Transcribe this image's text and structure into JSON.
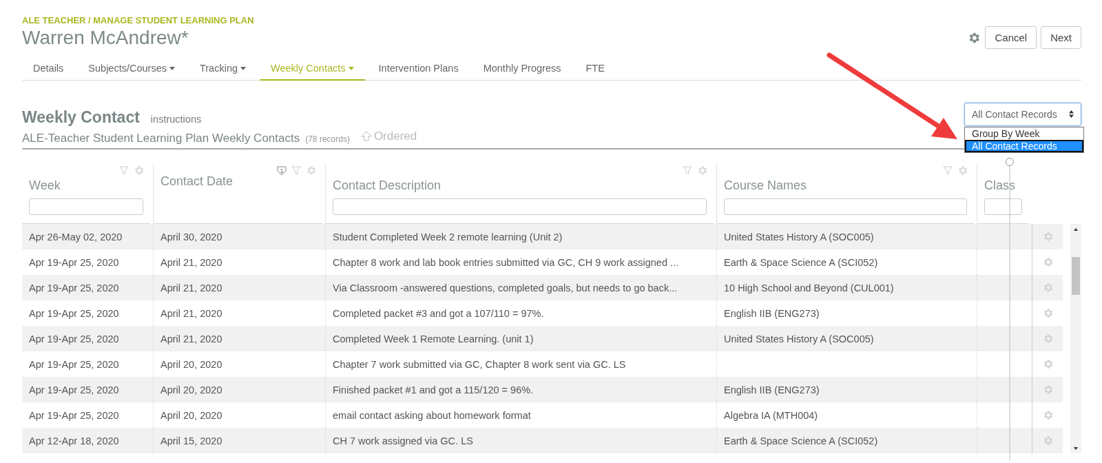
{
  "breadcrumb": "ALE TEACHER / MANAGE STUDENT LEARNING PLAN",
  "title": "Warren McAndrew*",
  "header_buttons": [
    "Cancel",
    "Next"
  ],
  "tabs": [
    {
      "label": "Details",
      "has_menu": false,
      "selected": false
    },
    {
      "label": "Subjects/Courses",
      "has_menu": true,
      "selected": false
    },
    {
      "label": "Tracking",
      "has_menu": true,
      "selected": false
    },
    {
      "label": "Weekly Contacts",
      "has_menu": true,
      "selected": true
    },
    {
      "label": "Intervention Plans",
      "has_menu": false,
      "selected": false
    },
    {
      "label": "Monthly Progress",
      "has_menu": false,
      "selected": false
    },
    {
      "label": "FTE",
      "has_menu": false,
      "selected": false
    }
  ],
  "section": {
    "title": "Weekly Contact",
    "link": "instructions"
  },
  "view_select": {
    "value": "All Contact Records",
    "options": [
      {
        "label": "Group By Week",
        "selected": false
      },
      {
        "label": "All Contact Records",
        "selected": true
      }
    ]
  },
  "list_title": {
    "title": "ALE-Teacher Student Learning Plan Weekly Contacts",
    "count": "(78 records)",
    "order": "Ordered"
  },
  "table": {
    "columns": [
      {
        "label": "Week",
        "tools": true,
        "filter_field": true
      },
      {
        "label": "Contact Date",
        "tools": true,
        "filter_field": false,
        "sort_badge": "1"
      },
      {
        "label": "Contact Description",
        "tools": true,
        "filter_field": true
      },
      {
        "label": "Course Names",
        "tools": true,
        "filter_field": true
      },
      {
        "label": "Class",
        "tools": false,
        "filter_field": true
      }
    ],
    "rows": [
      [
        "Apr 26-May 02, 2020",
        "April 30, 2020",
        "Student Completed Week 2 remote learning (Unit 2)",
        "United States History A (SOC005)"
      ],
      [
        "Apr 19-Apr 25, 2020",
        "April 21, 2020",
        "Chapter 8 work and lab book entries submitted via GC, CH 9 work assigned ...",
        "Earth & Space Science A (SCI052)"
      ],
      [
        "Apr 19-Apr 25, 2020",
        "April 21, 2020",
        "Via Classroom -answered questions, completed goals, but needs to go back...",
        "10 High School and Beyond (CUL001)"
      ],
      [
        "Apr 19-Apr 25, 2020",
        "April 21, 2020",
        "Completed packet #3 and got a 107/110 = 97%.",
        "English IIB (ENG273)"
      ],
      [
        "Apr 19-Apr 25, 2020",
        "April 21, 2020",
        "Completed Week 1 Remote Learning. (unit 1)",
        "United States History A (SOC005)"
      ],
      [
        "Apr 19-Apr 25, 2020",
        "April 20, 2020",
        "Chapter 7 work submitted via GC, Chapter 8 work sent via GC. LS",
        ""
      ],
      [
        "Apr 19-Apr 25, 2020",
        "April 20, 2020",
        "Finished packet #1 and got a 115/120 = 96%.",
        "English IIB (ENG273)"
      ],
      [
        "Apr 19-Apr 25, 2020",
        "April 20, 2020",
        "email contact asking about homework format",
        "Algebra IA (MTH004)"
      ],
      [
        "Apr 12-Apr 18, 2020",
        "April 15, 2020",
        "CH 7 work assigned via GC. LS",
        "Earth & Space Science A (SCI052)"
      ]
    ]
  }
}
